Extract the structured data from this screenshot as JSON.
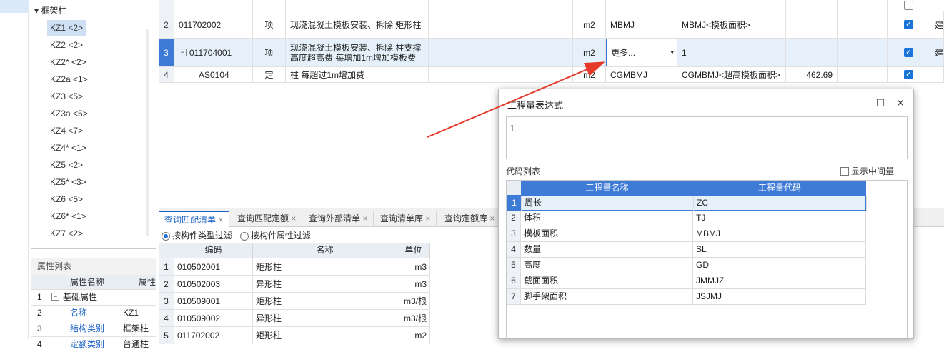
{
  "tree": {
    "group_label": "框架柱",
    "items": [
      "KZ1 <2>",
      "KZ2 <2>",
      "KZ2* <2>",
      "KZ2a <1>",
      "KZ3 <5>",
      "KZ3a <5>",
      "KZ4 <7>",
      "KZ4* <1>",
      "KZ5 <2>",
      "KZ5* <3>",
      "KZ6 <5>",
      "KZ6* <1>",
      "KZ7 <2>"
    ]
  },
  "props": {
    "title": "属性列表",
    "col_name": "属性名称",
    "col_value": "属性",
    "rows": [
      {
        "num": "1",
        "name": "基础属性",
        "value": ""
      },
      {
        "num": "2",
        "name": "名称",
        "value": "KZ1"
      },
      {
        "num": "3",
        "name": "结构类别",
        "value": "框架柱"
      },
      {
        "num": "4",
        "name": "定额类别",
        "value": "普通柱"
      }
    ]
  },
  "top_grid": {
    "rows": [
      {
        "num": "2",
        "code": "011702002",
        "type": "项",
        "name": "现浇混凝土模板安装、拆除 矩形柱",
        "unit": "m2",
        "expr": "MBMJ",
        "expr_desc": "MBMJ<模板面积>",
        "qty": "",
        "checked": true,
        "extra": "建"
      },
      {
        "num": "3",
        "code": "011704001",
        "type": "项",
        "name": "现浇混凝土模板安装、拆除 柱支撑高度超高费 每增加1m增加模板费",
        "unit": "m2",
        "expr": "更多...",
        "expr_desc": "1",
        "qty": "",
        "checked": true,
        "extra": "建"
      },
      {
        "num": "4",
        "code": "AS0104",
        "type": "定",
        "name": "柱 每超过1m增加费",
        "unit": "m2",
        "expr": "CGMBMJ",
        "expr_desc": "CGMBMJ<超高模板面积>",
        "qty": "462.69",
        "checked": true,
        "extra": ""
      }
    ]
  },
  "tabs": [
    "查询匹配清单",
    "查询匹配定额",
    "查询外部清单",
    "查询清单库",
    "查询定额库"
  ],
  "filter": {
    "opt1": "按构件类型过滤",
    "opt2": "按构件属性过滤"
  },
  "list_grid": {
    "col_code": "编码",
    "col_name": "名称",
    "col_unit": "单位",
    "rows": [
      {
        "num": "1",
        "code": "010502001",
        "name": "矩形柱",
        "unit": "m3"
      },
      {
        "num": "2",
        "code": "010502003",
        "name": "异形柱",
        "unit": "m3"
      },
      {
        "num": "3",
        "code": "010509001",
        "name": "矩形柱",
        "unit": "m3/根"
      },
      {
        "num": "4",
        "code": "010509002",
        "name": "异形柱",
        "unit": "m3/根"
      },
      {
        "num": "5",
        "code": "011702002",
        "name": "矩形柱",
        "unit": "m2"
      }
    ]
  },
  "dialog": {
    "title": "工程量表达式",
    "expression": "1",
    "code_list_label": "代码列表",
    "show_intermediate": "显示中间量",
    "col_name": "工程量名称",
    "col_code": "工程量代码",
    "rows": [
      {
        "num": "1",
        "name": "周长",
        "code": "ZC"
      },
      {
        "num": "2",
        "name": "体积",
        "code": "TJ"
      },
      {
        "num": "3",
        "name": "模板面积",
        "code": "MBMJ"
      },
      {
        "num": "4",
        "name": "数量",
        "code": "SL"
      },
      {
        "num": "5",
        "name": "高度",
        "code": "GD"
      },
      {
        "num": "6",
        "name": "截面面积",
        "code": "JMMJZ"
      },
      {
        "num": "7",
        "name": "脚手架面积",
        "code": "JSJMJ"
      }
    ]
  },
  "colors": {
    "accent": "#1d63c4",
    "header_blue": "#3e7bd6",
    "selection": "#e5f0fb",
    "arrow": "#e53a2a"
  }
}
